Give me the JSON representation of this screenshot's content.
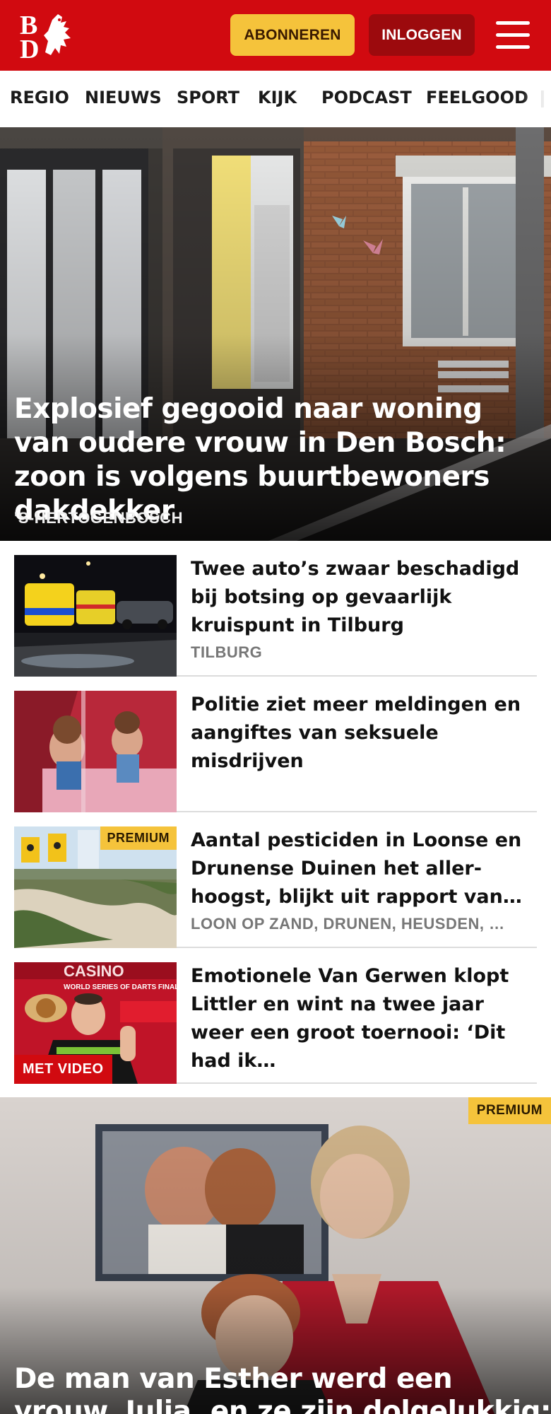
{
  "header": {
    "logo_letters": "BD",
    "subscribe_label": "ABONNEREN",
    "login_label": "INLOGGEN",
    "brand_color": "#d10a10",
    "menu_icon": "hamburger-menu-icon"
  },
  "nav": {
    "items": [
      "REGIO",
      "NIEUWS",
      "SPORT",
      "KIJK",
      "PODCAST",
      "FEELGOOD"
    ]
  },
  "hero": {
    "title": "Explosief gegooid naar woning van oudere vrouw in Den Bosch: zoon is volgens buurtbewoners dakdekker",
    "location": "'S-HERTOGENBOSCH"
  },
  "articles": [
    {
      "title": "Twee auto’s zwaar beschadigd bij botsing op gevaarlijk kruispunt in Tilburg",
      "location": "TILBURG",
      "badge": ""
    },
    {
      "title": "Politie ziet meer meldingen en aangiftes van seksuele misdrijven",
      "location": "",
      "badge": ""
    },
    {
      "title": "Aantal pesticiden in Loonse en Drunense Duinen het aller-hoogst, blijkt uit rapport van…",
      "location": "LOON OP ZAND, DRUNEN, HEUSDEN, …",
      "badge": "PREMIUM"
    },
    {
      "title": "Emotionele Van Gerwen klopt Littler en wint na twee jaar weer een groot toernooi: ‘Dit had ik…",
      "location": "",
      "badge": "MET VIDEO",
      "thumb_text": "WORLD SERIES OF DARTS FINALS"
    }
  ],
  "feature": {
    "badge": "PREMIUM",
    "title": "De man van Esther werd een vrouw, Julia, en ze zijn dolgelukkig: ‘We…"
  }
}
